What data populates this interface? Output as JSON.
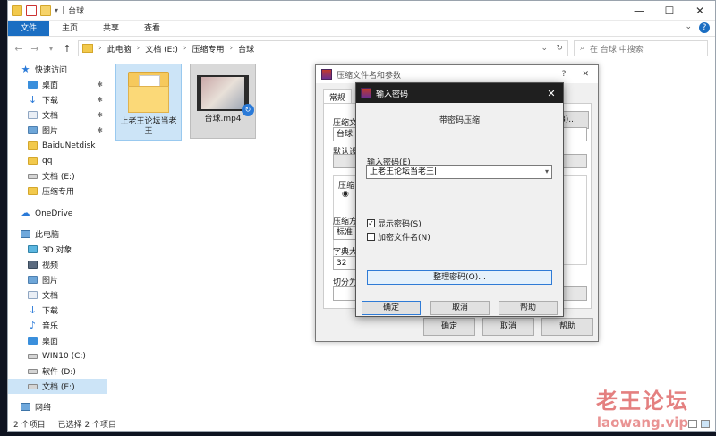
{
  "window": {
    "title": "台球",
    "controls": [
      "—",
      "☐",
      "✕"
    ]
  },
  "ribbon": {
    "tabs": [
      "文件",
      "主页",
      "共享",
      "查看"
    ],
    "active": 0
  },
  "address": {
    "crumbs": [
      "此电脑",
      "文档 (E:)",
      "压缩专用",
      "台球"
    ],
    "search_placeholder": "在 台球 中搜索"
  },
  "sidebar": [
    {
      "label": "快速访问",
      "icon": "star-icon"
    },
    {
      "label": "桌面",
      "icon": "desktop-icon",
      "pinned": true
    },
    {
      "label": "下载",
      "icon": "download-icon",
      "pinned": true
    },
    {
      "label": "文档",
      "icon": "document-icon",
      "pinned": true
    },
    {
      "label": "图片",
      "icon": "picture-icon",
      "pinned": true
    },
    {
      "label": "BaiduNetdisk",
      "icon": "folder-icon"
    },
    {
      "label": "qq",
      "icon": "folder-icon"
    },
    {
      "label": "文档 (E:)",
      "icon": "drive-icon"
    },
    {
      "label": "压缩专用",
      "icon": "folder-icon"
    },
    {
      "label": "OneDrive",
      "icon": "cloud-icon"
    },
    {
      "label": "此电脑",
      "icon": "pc-icon"
    },
    {
      "label": "3D 对象",
      "icon": "3d-objects-icon"
    },
    {
      "label": "视频",
      "icon": "video-icon"
    },
    {
      "label": "图片",
      "icon": "picture-icon"
    },
    {
      "label": "文档",
      "icon": "document-icon"
    },
    {
      "label": "下载",
      "icon": "download-icon"
    },
    {
      "label": "音乐",
      "icon": "music-icon"
    },
    {
      "label": "桌面",
      "icon": "desktop-icon"
    },
    {
      "label": "WIN10 (C:)",
      "icon": "drive-icon"
    },
    {
      "label": "软件 (D:)",
      "icon": "drive-icon"
    },
    {
      "label": "文档 (E:)",
      "icon": "drive-icon",
      "selected": true
    },
    {
      "label": "网络",
      "icon": "network-icon"
    }
  ],
  "files": [
    {
      "name": "上老王论坛当老王",
      "type": "folder"
    },
    {
      "name": "台球.mp4",
      "type": "video"
    }
  ],
  "status": {
    "count": "2 个项目",
    "selected": "已选择 2 个项目"
  },
  "archive_dialog": {
    "title": "压缩文件名和参数",
    "tab": "常规",
    "archive_name_label": "压缩文",
    "archive_name_value": "台球.r",
    "browse_label": "浏览(B)...",
    "profile_label": "默认设",
    "format_label": "压缩",
    "method_label": "压缩方",
    "method_value": "标准",
    "dict_label": "字典大",
    "dict_value": "32",
    "split_label": "切分为",
    "ok": "确定",
    "cancel": "取消",
    "help": "帮助"
  },
  "password_dialog": {
    "title": "输入密码",
    "heading": "带密码压缩",
    "label": "输入密码(E)",
    "value": "上老王论坛当老王",
    "show_password": "显示密码(S)",
    "show_checked": true,
    "encrypt_names": "加密文件名(N)",
    "encrypt_checked": false,
    "organize": "整理密码(O)...",
    "ok": "确定",
    "cancel": "取消",
    "help": "帮助"
  },
  "watermark": {
    "cn": "老王论坛",
    "en": "laowang.vip"
  }
}
